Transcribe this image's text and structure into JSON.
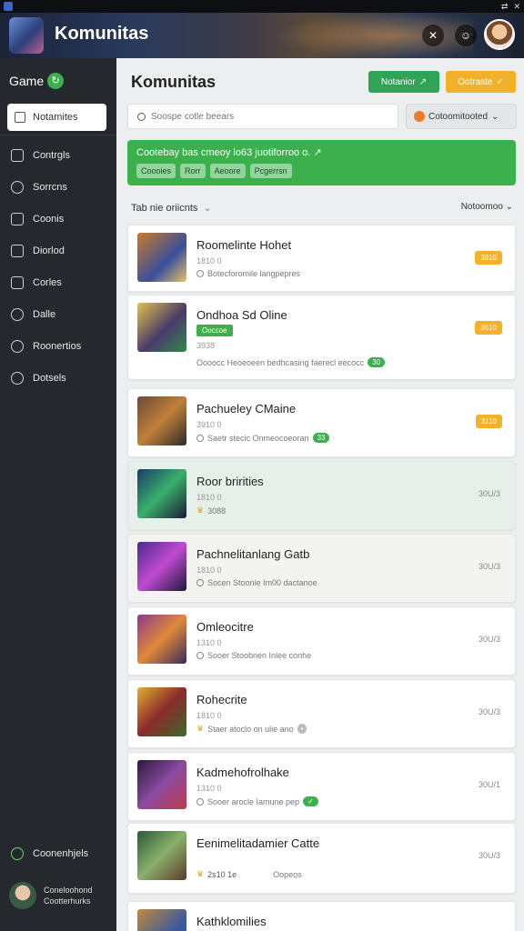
{
  "app": {
    "title": "Komunitas",
    "system_icons": [
      "⇄",
      "✕"
    ]
  },
  "header": {
    "buttons": [
      {
        "icon": "shuffle-icon",
        "glyph": "✕"
      },
      {
        "icon": "avatar-small",
        "glyph": "☺"
      }
    ]
  },
  "sidebar": {
    "brand": "Game",
    "brand_badge": "↻",
    "active_item": "Notamites",
    "items": [
      {
        "label": "Contrgls",
        "icon": "grid-icon"
      },
      {
        "label": "Sorrcns",
        "icon": "star-icon"
      },
      {
        "label": "Coonis",
        "icon": "chat-icon"
      },
      {
        "label": "Diorlod",
        "icon": "document-icon"
      },
      {
        "label": "Corles",
        "icon": "edit-icon"
      },
      {
        "label": "Dalle",
        "icon": "leaf-icon"
      },
      {
        "label": "Roonertios",
        "icon": "search-icon"
      },
      {
        "label": "Dotsels",
        "icon": "message-icon"
      }
    ],
    "bottom_item": "Coonenhjels",
    "profile": {
      "line1": "Coneloohond",
      "line2": "Cootterhurks"
    }
  },
  "main": {
    "title": "Komunitas",
    "primary_button": "Notanior",
    "secondary_button": "Ootraste",
    "search_placeholder": "Soospe cotle beears",
    "filter_label": "Cotoomitooted",
    "banner": {
      "text": "Cootebay bas cmeoy lo63 juotiforroo o. ↗",
      "tags": [
        "Coooies",
        "Rorr",
        "Aeoore",
        "Pcgerrsn"
      ]
    },
    "list_heading": "Tab nie oriicnts",
    "sort_label": "Notoomoo"
  },
  "cards": [
    {
      "name": "Roomelinte Hohet",
      "meta": "1810 0",
      "desc": "Botecforomile langpepres",
      "badge": "3910",
      "right": ""
    },
    {
      "name": "Ondhoa Sd Oline",
      "meta": "3938",
      "label": "Ooccoe",
      "desc": "Oooocc Heoeoeen bedhcasing faerecl eecocc",
      "desc_chip": "30",
      "badge": "3610",
      "right": ""
    },
    {
      "name": "Pachueley CMaine",
      "meta": "3910 0",
      "desc": "Saetr stecic Onmeocoeoran",
      "desc_chip": "33",
      "badge": "3110",
      "right": ""
    },
    {
      "name": "Roor bririties",
      "meta": "1810 0",
      "desc": "3088",
      "badge": "",
      "right": "30U/3"
    },
    {
      "name": "Pachnelitanlang Gatb",
      "meta": "1810 0",
      "desc": "Socen Stoonie Im00 dactanoe",
      "badge": "",
      "right": "30U/3"
    },
    {
      "name": "Omleocitre",
      "meta": "1310 0",
      "desc": "Sooer Stoobnen Inlee conhe",
      "badge": "",
      "right": "30U/3"
    },
    {
      "name": "Rohecrite",
      "meta": "1810 0",
      "desc": "Staer atoclo on ulie ano",
      "badge": "",
      "right": "30U/3"
    },
    {
      "name": "Kadmehofrolhake",
      "meta": "1310 0",
      "desc": "Sooer arocle Iamune pep",
      "badge": "",
      "right": "30U/1"
    },
    {
      "name": "Eenimelitadamier Catte",
      "meta": "2s10 1e",
      "desc": "Oopeos",
      "badge": "",
      "right": "30U/3"
    },
    {
      "name": "Kathklomilies",
      "meta": "",
      "desc": "",
      "badge": "",
      "right": ""
    }
  ]
}
